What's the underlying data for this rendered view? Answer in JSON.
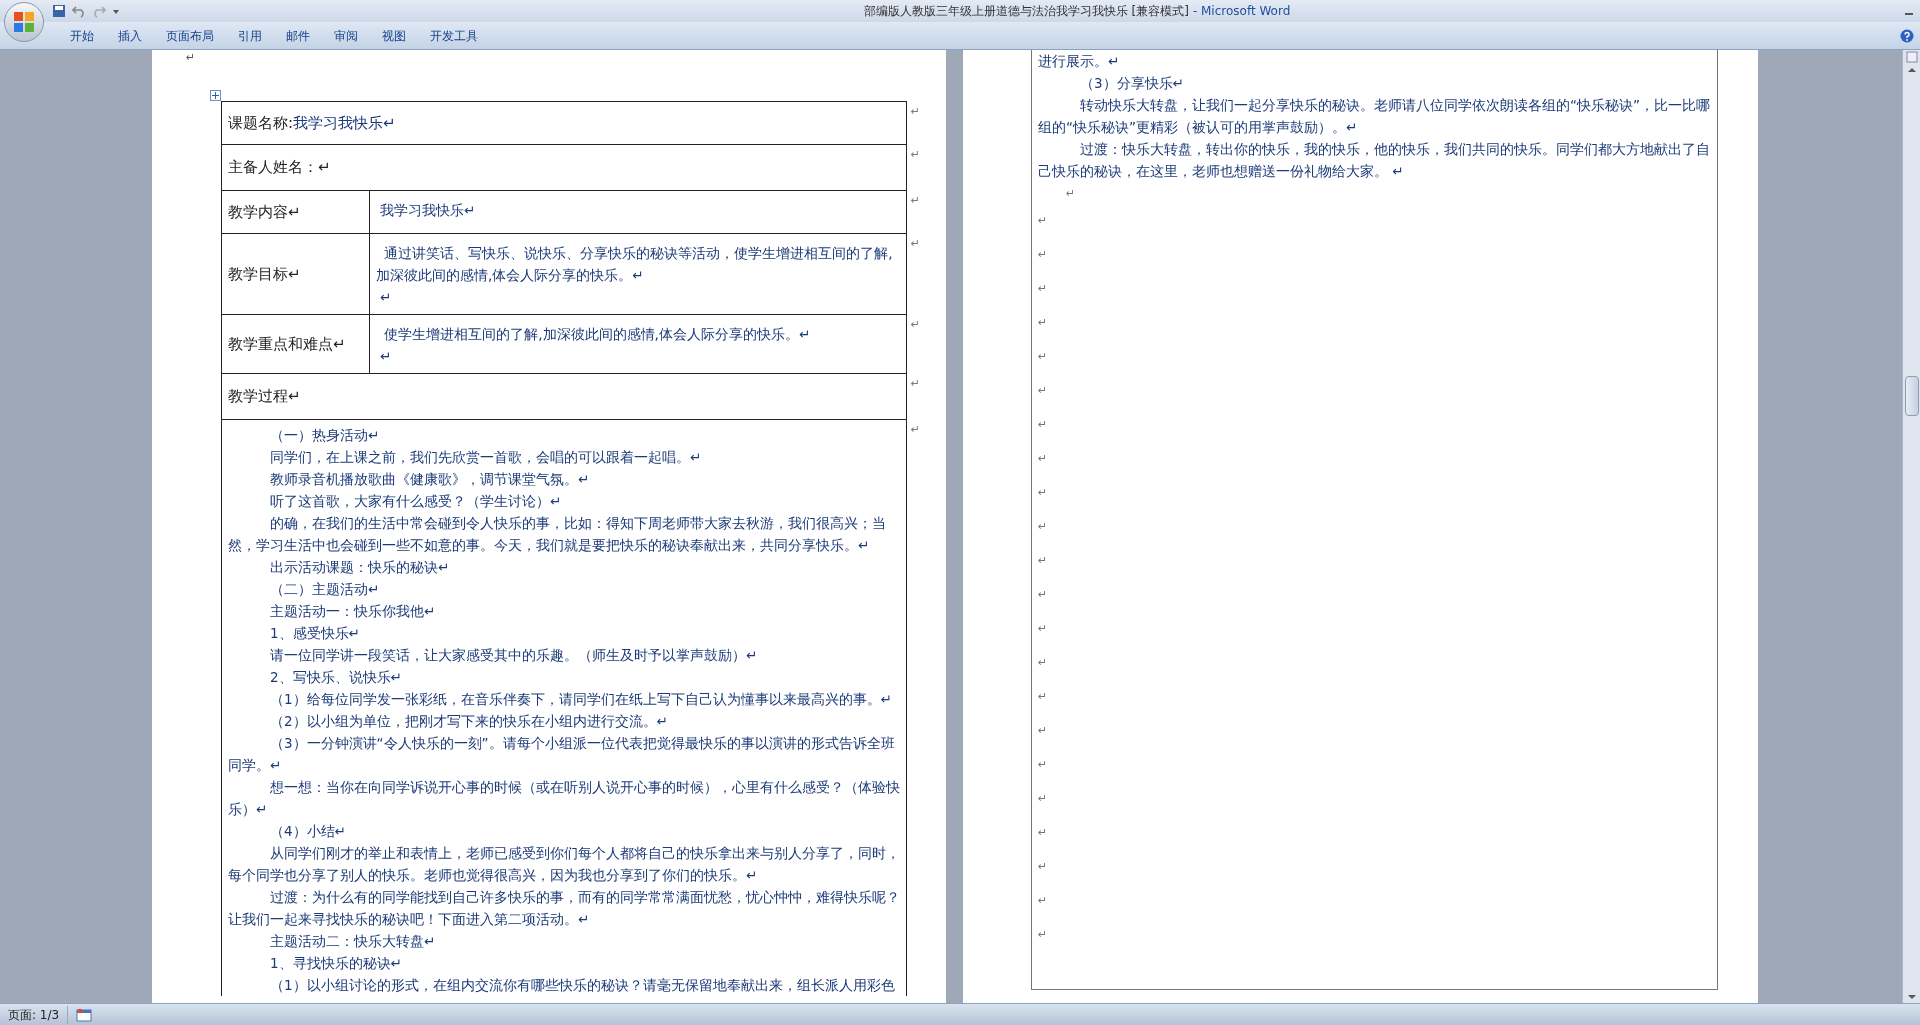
{
  "window": {
    "title": "部编版人教版三年级上册道德与法治我学习我快乐 [兼容模式]",
    "app": "- Microsoft Word"
  },
  "ribbon_tabs": [
    "开始",
    "插入",
    "页面布局",
    "引用",
    "邮件",
    "审阅",
    "视图",
    "开发工具"
  ],
  "left_page": {
    "top_mark": "↵",
    "table": {
      "rows": [
        {
          "kind": "full",
          "label": "课题名称:",
          "value": "我学习我快乐↵",
          "end_mark": "↵"
        },
        {
          "kind": "full",
          "label": "主备人姓名：↵",
          "end_mark": "↵"
        },
        {
          "kind": "split",
          "label": "教学内容↵",
          "paragraphs": [
            "我学习我快乐↵"
          ],
          "end_mark": "↵"
        },
        {
          "kind": "split",
          "label": "教学目标↵",
          "paragraphs": [
            " 通过讲笑话、写快乐、说快乐、分享快乐的秘诀等活动，使学生增进相互间的了解,加深彼此间的感情,体会人际分享的快乐。↵",
            "↵"
          ],
          "end_mark": "↵"
        },
        {
          "kind": "split",
          "label": "教学重点和难点↵",
          "paragraphs": [
            " 使学生增进相互间的了解,加深彼此间的感情,体会人际分享的快乐。↵",
            "↵"
          ],
          "end_mark": "↵"
        },
        {
          "kind": "full",
          "label": "教学过程↵",
          "end_mark": "↵"
        },
        {
          "kind": "body",
          "end_mark": "↵",
          "paragraphs": [
            "（一）热身活动↵",
            "同学们，在上课之前，我们先欣赏一首歌，会唱的可以跟着一起唱。↵",
            "教师录音机播放歌曲《健康歌》，调节课堂气氛。↵",
            "听了这首歌，大家有什么感受？（学生讨论）↵",
            "的确，在我们的生活中常会碰到令人快乐的事，比如：得知下周老师带大家去秋游，我们很高兴；当然，学习生活中也会碰到一些不如意的事。今天，我们就是要把快乐的秘诀奉献出来，共同分享快乐。↵",
            "出示活动课题：快乐的秘诀↵",
            "（二）主题活动↵",
            "主题活动一：快乐你我他↵",
            "1、感受快乐↵",
            "请一位同学讲一段笑话，让大家感受其中的乐趣。（师生及时予以掌声鼓励）↵",
            "2、写快乐、说快乐↵",
            "（1）给每位同学发一张彩纸，在音乐伴奏下，请同学们在纸上写下自己认为懂事以来最高兴的事。↵",
            "（2）以小组为单位，把刚才写下来的快乐在小组内进行交流。↵",
            "（3）一分钟演讲“令人快乐的一刻”。请每个小组派一位代表把觉得最快乐的事以演讲的形式告诉全班同学。↵",
            "想一想：当你在向同学诉说开心事的时候（或在听别人说开心事的时候），心里有什么感受？（体验快乐）↵",
            "（4）小结↵",
            "从同学们刚才的举止和表情上，老师已感受到你们每个人都将自己的快乐拿出来与别人分享了，同时，每个同学也分享了别人的快乐。老师也觉得很高兴，因为我也分享到了你们的快乐。↵",
            "过渡：为什么有的同学能找到自己许多快乐的事，而有的同学常常满面忧愁，忧心忡忡，难得快乐呢？让我们一起来寻找快乐的秘诀吧！下面进入第二项活动。↵",
            "主题活动二：快乐大转盘↵",
            "1、寻找快乐的秘诀↵",
            "（1）以小组讨论的形式，在组内交流你有哪些快乐的秘诀？请毫无保留地奉献出来，组长派人用彩色"
          ]
        }
      ]
    }
  },
  "right_page": {
    "paragraphs": [
      {
        "kind": "continuation",
        "text": "进行展示。↵"
      },
      {
        "kind": "indented",
        "text": "（3）分享快乐↵"
      },
      {
        "kind": "indented",
        "text": "转动快乐大转盘，让我们一起分享快乐的秘诀。老师请八位同学依次朗读各组的“快乐秘诀”，比一比哪组的“快乐秘诀”更精彩（被认可的用掌声鼓励）。↵"
      },
      {
        "kind": "indented",
        "text": "过渡：快乐大转盘，转出你的快乐，我的快乐，他的快乐，我们共同的快乐。同学们都大方地献出了自己快乐的秘诀，在这里，老师也想赠送一份礼物给大家。 ↵"
      },
      {
        "kind": "mark",
        "text": "↵"
      },
      {
        "kind": "empty",
        "text": "↵"
      },
      {
        "kind": "empty",
        "text": "↵"
      },
      {
        "kind": "empty",
        "text": "↵"
      },
      {
        "kind": "empty",
        "text": "↵"
      },
      {
        "kind": "empty",
        "text": "↵"
      },
      {
        "kind": "empty",
        "text": "↵"
      },
      {
        "kind": "empty",
        "text": "↵"
      },
      {
        "kind": "empty",
        "text": "↵"
      },
      {
        "kind": "empty",
        "text": "↵"
      },
      {
        "kind": "empty",
        "text": "↵"
      },
      {
        "kind": "empty",
        "text": "↵"
      },
      {
        "kind": "empty",
        "text": "↵"
      },
      {
        "kind": "empty",
        "text": "↵"
      },
      {
        "kind": "empty",
        "text": "↵"
      },
      {
        "kind": "empty",
        "text": "↵"
      },
      {
        "kind": "empty",
        "text": "↵"
      },
      {
        "kind": "empty",
        "text": "↵"
      },
      {
        "kind": "empty",
        "text": "↵"
      },
      {
        "kind": "empty",
        "text": "↵"
      },
      {
        "kind": "empty",
        "text": "↵"
      },
      {
        "kind": "empty",
        "text": "↵"
      },
      {
        "kind": "empty",
        "text": "↵"
      }
    ]
  },
  "status_bar": {
    "page": "页面: 1/3"
  }
}
